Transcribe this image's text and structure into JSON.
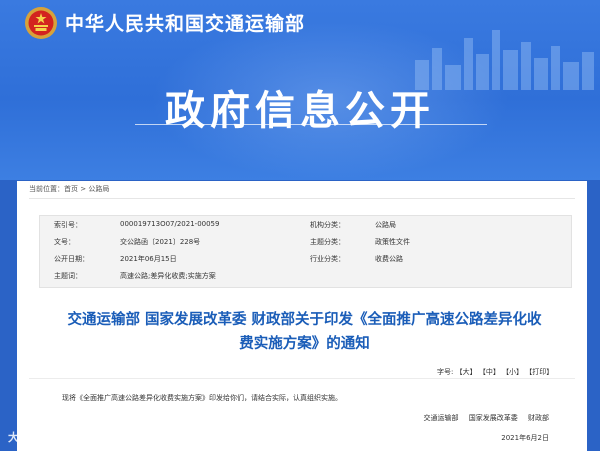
{
  "header": {
    "site_title": "中华人民共和国交通运输部",
    "banner_title": "政府信息公开"
  },
  "breadcrumb": {
    "prefix": "当前位置：",
    "home": "首页",
    "separator": ">",
    "current": "公路局"
  },
  "meta": {
    "rows": [
      {
        "label": "索引号：",
        "value": "000019713O07/2021-00059",
        "label2": "机构分类：",
        "value2": "公路局"
      },
      {
        "label": "文号：",
        "value": "交公路函〔2021〕228号",
        "label2": "主题分类：",
        "value2": "政策性文件"
      },
      {
        "label": "公开日期：",
        "value": "2021年06月15日",
        "label2": "行业分类：",
        "value2": "收费公路"
      },
      {
        "label": "主题词：",
        "value": "高速公路;差异化收费;实施方案"
      }
    ]
  },
  "document": {
    "title_line1": "交通运输部 国家发展改革委 财政部关于印发《全面推广高速公路差异化收",
    "title_line2": "费实施方案》的通知",
    "font_size_label": "字号:",
    "font_large": "【大】",
    "font_medium": "【中】",
    "font_small": "【小】",
    "print_label": "【打印】",
    "body": "现将《全面推广高速公路差异化收费实施方案》印发给你们，请结合实际，认真组织实施。",
    "signers": [
      "交通运输部",
      "国家发展改革委",
      "财政部"
    ],
    "date": "2021年6月2日"
  },
  "watermark": "大敏网络",
  "colors": {
    "brand_blue": "#2f6fd8",
    "title_blue": "#1a5db8"
  }
}
